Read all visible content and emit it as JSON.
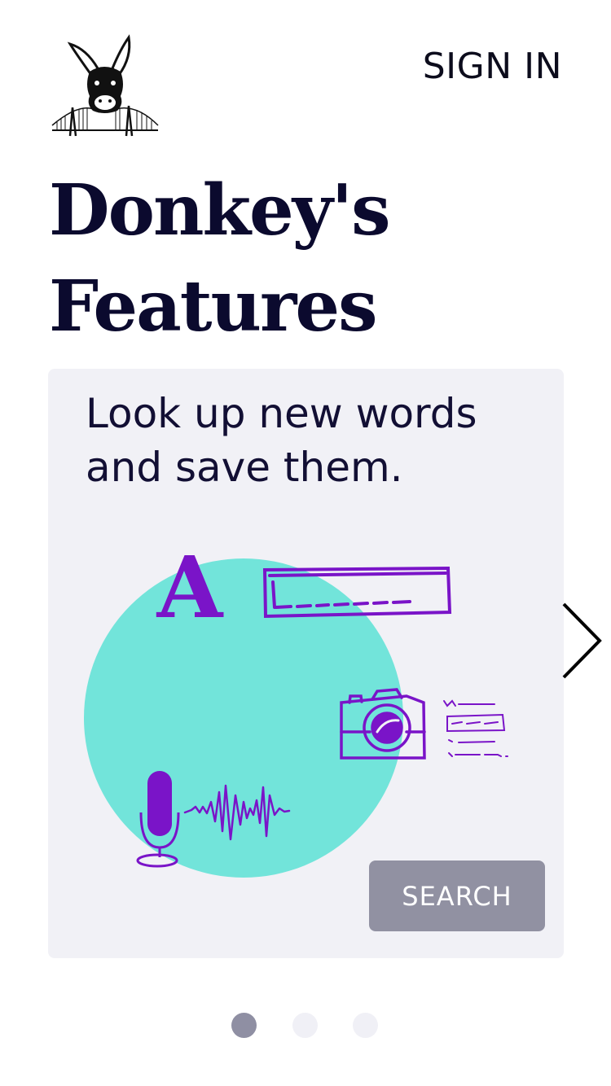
{
  "header": {
    "logo_icon": "donkey-bridge-logo-icon",
    "sign_in_label": "SIGN IN"
  },
  "title": {
    "line1": "Donkey's",
    "line2": "Features"
  },
  "feature_card": {
    "text": "Look up new words and save them.",
    "illustration_letter": "A",
    "search_button_label": "SEARCH",
    "colors": {
      "card_bg": "#f1f1f6",
      "circle": "#72e4da",
      "accent": "#7a14c8",
      "button": "#9191a2"
    }
  },
  "carousel": {
    "next_icon": "chevron-right-icon",
    "total_pages": 3,
    "active_page": 1
  }
}
